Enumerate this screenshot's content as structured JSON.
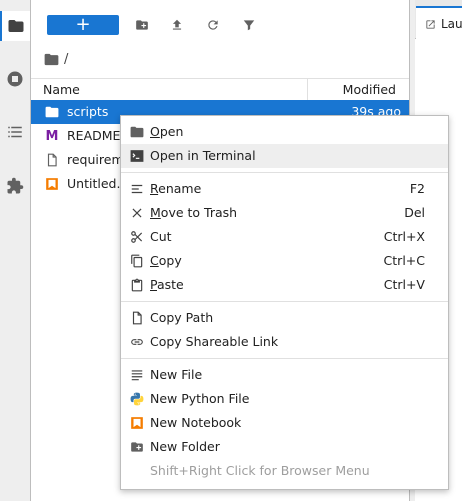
{
  "file_browser": {
    "breadcrumb_root": "/",
    "columns": {
      "name": "Name",
      "modified": "Modified"
    },
    "files": [
      {
        "name": "scripts",
        "modified": "39s ago",
        "icon": "folder-icon",
        "selected": true
      },
      {
        "name": "README",
        "modified": "",
        "icon": "markdown-icon",
        "selected": false
      },
      {
        "name": "requirem",
        "modified": "",
        "icon": "file-icon",
        "selected": false
      },
      {
        "name": "Untitled.i",
        "modified": "",
        "icon": "notebook-icon",
        "selected": false
      }
    ],
    "toolbar": {
      "new_launcher_label": "+",
      "icons": [
        "new-folder-icon",
        "upload-icon",
        "refresh-icon",
        "filter-icon"
      ]
    }
  },
  "main_area": {
    "tabs": [
      {
        "label": "Lau",
        "icon": "launcher-icon"
      }
    ]
  },
  "context_menu": {
    "items": [
      {
        "pre": "",
        "ul": "O",
        "post": "pen",
        "shortcut": "",
        "icon": "folder-icon"
      },
      {
        "pre": "Open in Terminal",
        "ul": "",
        "post": "",
        "shortcut": "",
        "icon": "terminal-icon"
      },
      {
        "pre": "",
        "ul": "R",
        "post": "ename",
        "shortcut": "F2",
        "icon": "rename-icon"
      },
      {
        "pre": "",
        "ul": "M",
        "post": "ove to Trash",
        "shortcut": "Del",
        "icon": "close-icon"
      },
      {
        "pre": "Cut",
        "ul": "",
        "post": "",
        "shortcut": "Ctrl+X",
        "icon": "cut-icon"
      },
      {
        "pre": "",
        "ul": "C",
        "post": "opy",
        "shortcut": "Ctrl+C",
        "icon": "copy-icon"
      },
      {
        "pre": "",
        "ul": "P",
        "post": "aste",
        "shortcut": "Ctrl+V",
        "icon": "paste-icon"
      },
      {
        "pre": "Copy Path",
        "ul": "",
        "post": "",
        "shortcut": "",
        "icon": "file-icon"
      },
      {
        "pre": "Copy Shareable Link",
        "ul": "",
        "post": "",
        "shortcut": "",
        "icon": "link-icon"
      },
      {
        "pre": "New File",
        "ul": "",
        "post": "",
        "shortcut": "",
        "icon": "text-file-icon"
      },
      {
        "pre": "New Python File",
        "ul": "",
        "post": "",
        "shortcut": "",
        "icon": "python-icon"
      },
      {
        "pre": "New Notebook",
        "ul": "",
        "post": "",
        "shortcut": "",
        "icon": "notebook-icon"
      },
      {
        "pre": "New Folder",
        "ul": "",
        "post": "",
        "shortcut": "",
        "icon": "new-folder-icon"
      },
      {
        "pre": "Shift+Right Click for Browser Menu",
        "ul": "",
        "post": "",
        "shortcut": "",
        "icon": ""
      }
    ]
  },
  "colors": {
    "accent": "#1976d2",
    "notebook_orange": "#f57c00",
    "markdown_purple": "#7b1fa2"
  }
}
